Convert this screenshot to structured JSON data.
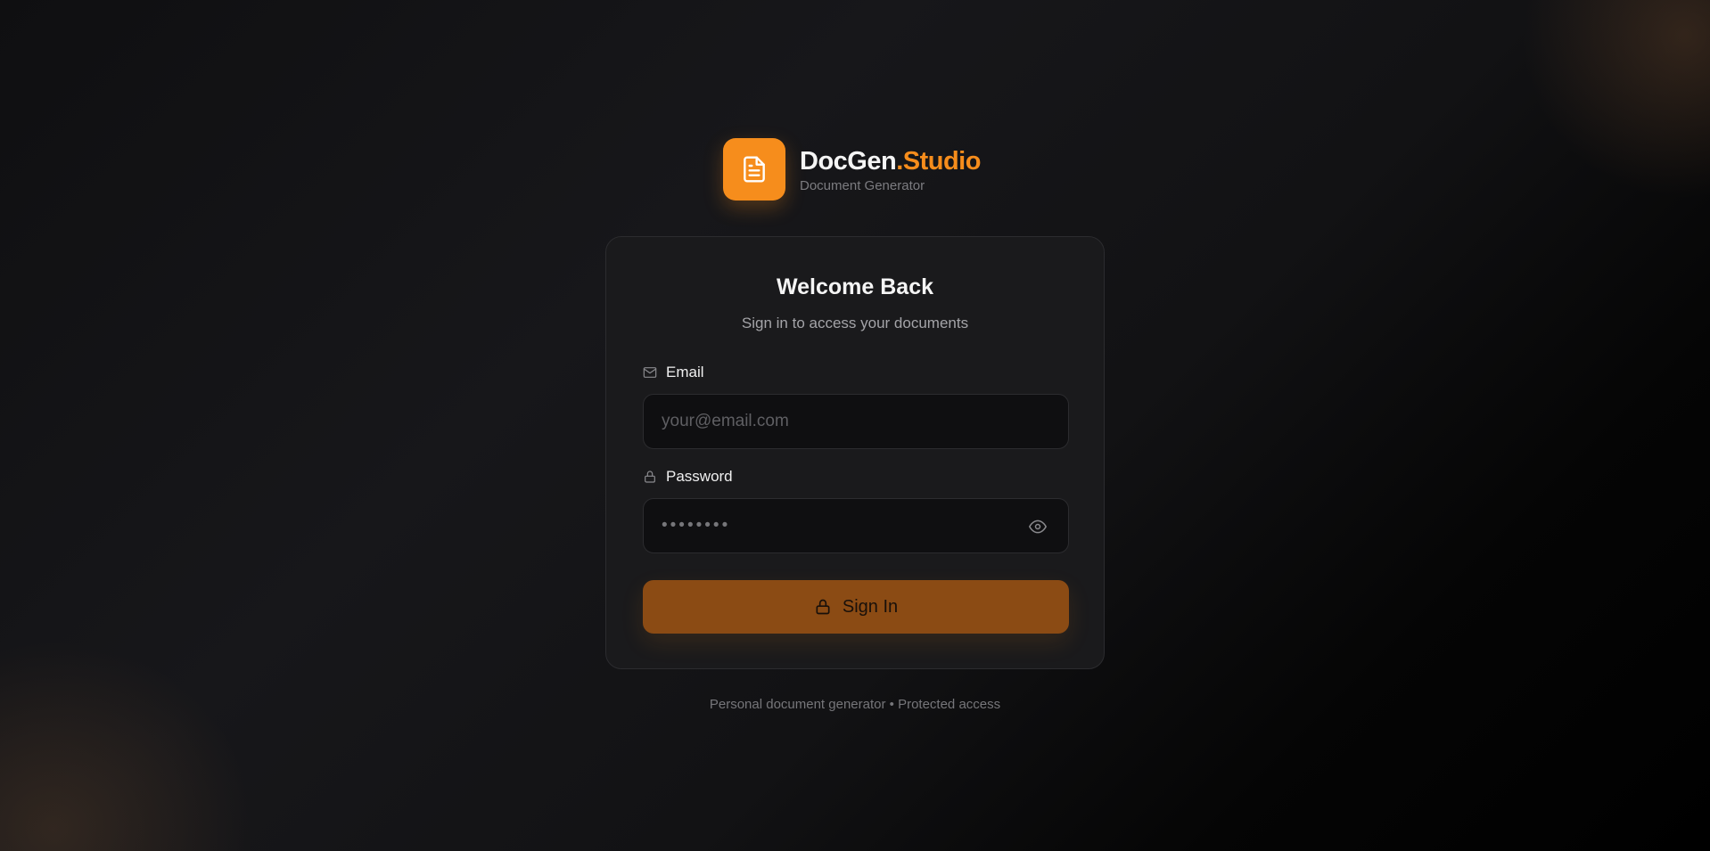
{
  "brand": {
    "name_primary": "DocGen",
    "name_accent": ".Studio",
    "subtitle": "Document Generator",
    "logo_icon": "document-icon",
    "accent_color": "#f68d1c"
  },
  "login": {
    "title": "Welcome Back",
    "subtitle": "Sign in to access your documents",
    "email": {
      "label": "Email",
      "icon": "mail-icon",
      "placeholder": "your@email.com",
      "value": ""
    },
    "password": {
      "label": "Password",
      "icon": "lock-icon",
      "placeholder": "••••••••",
      "value": "",
      "toggle_icon": "eye-icon"
    },
    "submit": {
      "label": "Sign In",
      "icon": "lock-icon",
      "color": "#8b4b14"
    }
  },
  "footer": {
    "text": "Personal document generator • Protected access"
  }
}
